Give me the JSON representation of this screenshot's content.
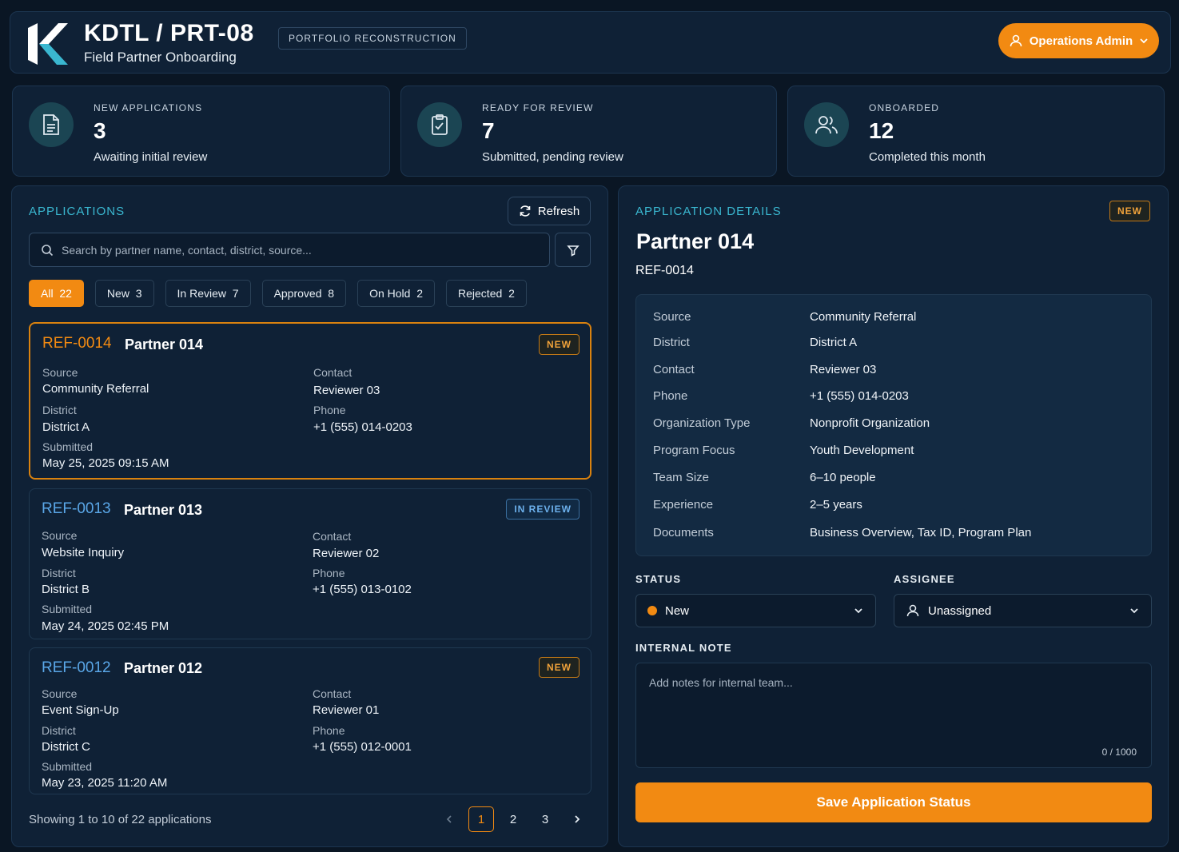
{
  "header": {
    "title": "KDTL / PRT-08",
    "subtitle": "Field Partner Onboarding",
    "tag": "PORTFOLIO RECONSTRUCTION",
    "user_label": "Operations Admin",
    "logo_icon": "k-logo",
    "user_icon": "user-icon"
  },
  "stats": [
    {
      "label": "NEW APPLICATIONS",
      "value": "3",
      "desc": "Awaiting initial review",
      "icon": "document-icon"
    },
    {
      "label": "READY FOR REVIEW",
      "value": "7",
      "desc": "Submitted, pending review",
      "icon": "clipboard-check-icon"
    },
    {
      "label": "ONBOARDED",
      "value": "12",
      "desc": "Completed this month",
      "icon": "users-icon"
    }
  ],
  "applications": {
    "title": "APPLICATIONS",
    "refresh_label": "Refresh",
    "search_placeholder": "Search by partner name, contact, district, source...",
    "filters": [
      {
        "label": "All",
        "count": "22"
      },
      {
        "label": "New",
        "count": "3"
      },
      {
        "label": "In Review",
        "count": "7"
      },
      {
        "label": "Approved",
        "count": "8"
      },
      {
        "label": "On Hold",
        "count": "2"
      },
      {
        "label": "Rejected",
        "count": "2"
      }
    ],
    "field_labels": {
      "source": "Source",
      "contact": "Contact",
      "district": "District",
      "phone": "Phone",
      "submitted": "Submitted"
    },
    "cards": [
      {
        "ref": "REF-0014",
        "name": "Partner 014",
        "badge": "NEW",
        "source": "Community Referral",
        "contact": "Reviewer 03",
        "district": "District A",
        "phone": "+1 (555) 014-0203",
        "submitted": "May 25, 2025 09:15 AM"
      },
      {
        "ref": "REF-0013",
        "name": "Partner 013",
        "badge": "IN REVIEW",
        "source": "Website Inquiry",
        "contact": "Reviewer 02",
        "district": "District B",
        "phone": "+1 (555) 013-0102",
        "submitted": "May 24, 2025 02:45 PM"
      },
      {
        "ref": "REF-0012",
        "name": "Partner 012",
        "badge": "NEW",
        "source": "Event Sign-Up",
        "contact": "Reviewer 01",
        "district": "District C",
        "phone": "+1 (555) 012-0001",
        "submitted": "May 23, 2025 11:20 AM"
      }
    ],
    "pagination": {
      "info": "Showing 1 to 10 of 22 applications",
      "pages": [
        "1",
        "2",
        "3"
      ],
      "current": "1"
    }
  },
  "details": {
    "title": "APPLICATION DETAILS",
    "badge": "NEW",
    "name": "Partner 014",
    "ref": "REF-0014",
    "rows": [
      {
        "k": "Source",
        "v": "Community Referral"
      },
      {
        "k": "District",
        "v": "District A"
      },
      {
        "k": "Contact",
        "v": "Reviewer 03"
      },
      {
        "k": "Phone",
        "v": "+1 (555) 014-0203"
      },
      {
        "k": "Organization Type",
        "v": "Nonprofit Organization"
      },
      {
        "k": "Program Focus",
        "v": "Youth Development"
      },
      {
        "k": "Team Size",
        "v": "6–10 people"
      },
      {
        "k": "Experience",
        "v": "2–5 years"
      },
      {
        "k": "Documents",
        "v": "Business Overview, Tax ID, Program Plan"
      }
    ],
    "status_label": "STATUS",
    "status_value": "New",
    "assignee_label": "ASSIGNEE",
    "assignee_value": "Unassigned",
    "note_label": "INTERNAL NOTE",
    "note_placeholder": "Add notes for internal team...",
    "note_counter": "0 / 1000",
    "save_label": "Save Application Status"
  },
  "colors": {
    "accent": "#f28a12",
    "teal": "#3ab7d0",
    "panel": "#0f2136",
    "background": "#0a1624"
  }
}
